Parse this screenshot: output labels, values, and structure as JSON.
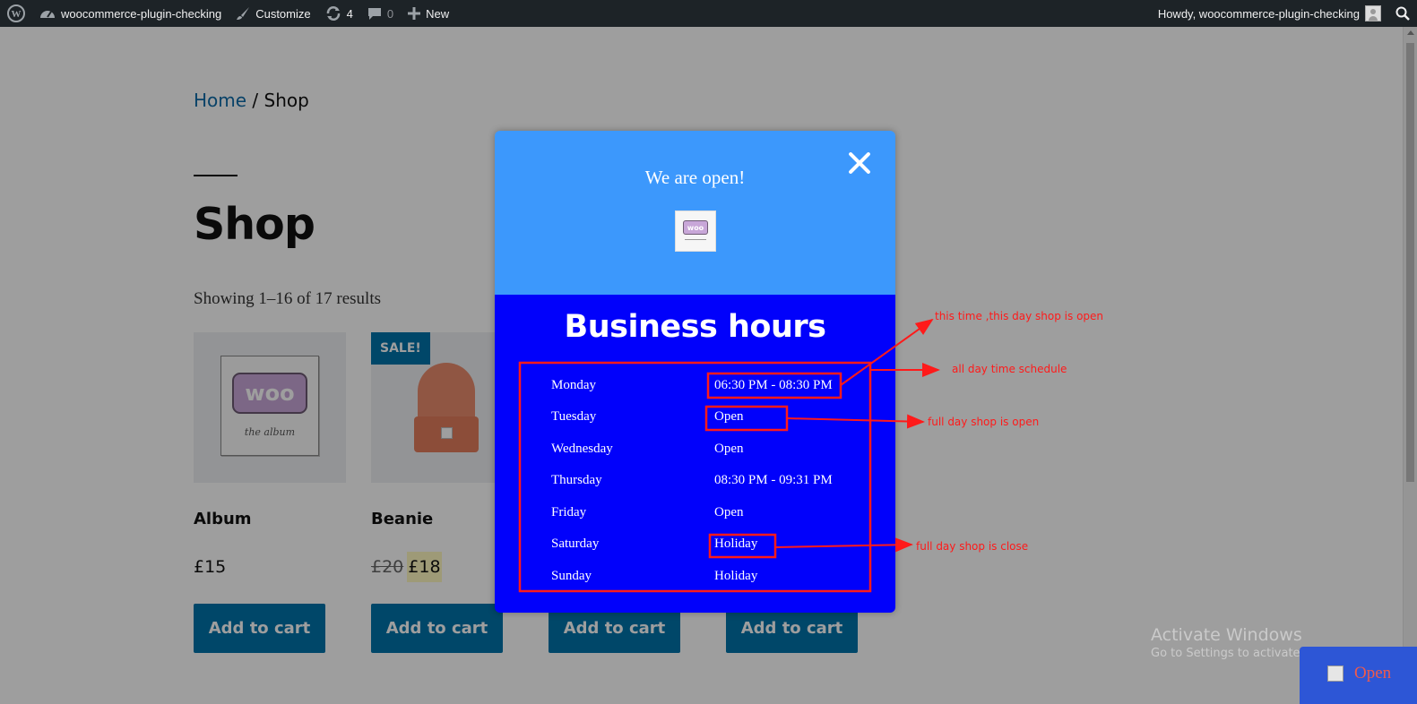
{
  "adminbar": {
    "site_name": "woocommerce-plugin-checking",
    "customize": "Customize",
    "updates_count": "4",
    "comments_count": "0",
    "new_label": "New",
    "howdy": "Howdy, woocommerce-plugin-checking"
  },
  "breadcrumb": {
    "home": "Home",
    "separator": " / ",
    "current": "Shop"
  },
  "page": {
    "title": "Shop",
    "results": "Showing 1–16 of 17 results"
  },
  "products": [
    {
      "name": "Album",
      "price": "£15",
      "button": "Add to cart",
      "art_text": "woo",
      "art_caption": "the album"
    },
    {
      "name": "Beanie",
      "old_price": "£20",
      "price": "£18",
      "sale_badge": "SALE!",
      "button": "Add to cart"
    },
    {
      "button": "Add to cart"
    },
    {
      "button": "Add to cart"
    }
  ],
  "modal": {
    "status": "We are open!",
    "logo_text": "woo",
    "heading": "Business hours",
    "hours": [
      {
        "day": "Monday",
        "time": "06:30 PM - 08:30 PM"
      },
      {
        "day": "Tuesday",
        "time": "Open"
      },
      {
        "day": "Wednesday",
        "time": "Open"
      },
      {
        "day": "Thursday",
        "time": "08:30 PM - 09:31 PM"
      },
      {
        "day": "Friday",
        "time": "Open"
      },
      {
        "day": "Saturday",
        "time": "Holiday"
      },
      {
        "day": "Sunday",
        "time": "Holiday"
      }
    ]
  },
  "annotations": {
    "a1": "this time ,this day shop is open",
    "a2": "all day time schedule",
    "a3": "full day shop is open",
    "a4": "full day shop is close"
  },
  "windows_watermark": {
    "line1": "Activate Windows",
    "line2": "Go to Settings to activate Windows."
  },
  "open_badge": "Open",
  "colors": {
    "modal_header": "#3c98fc",
    "modal_body": "#0101fb",
    "annotation": "#ff1a1a",
    "button": "#0073aa"
  }
}
